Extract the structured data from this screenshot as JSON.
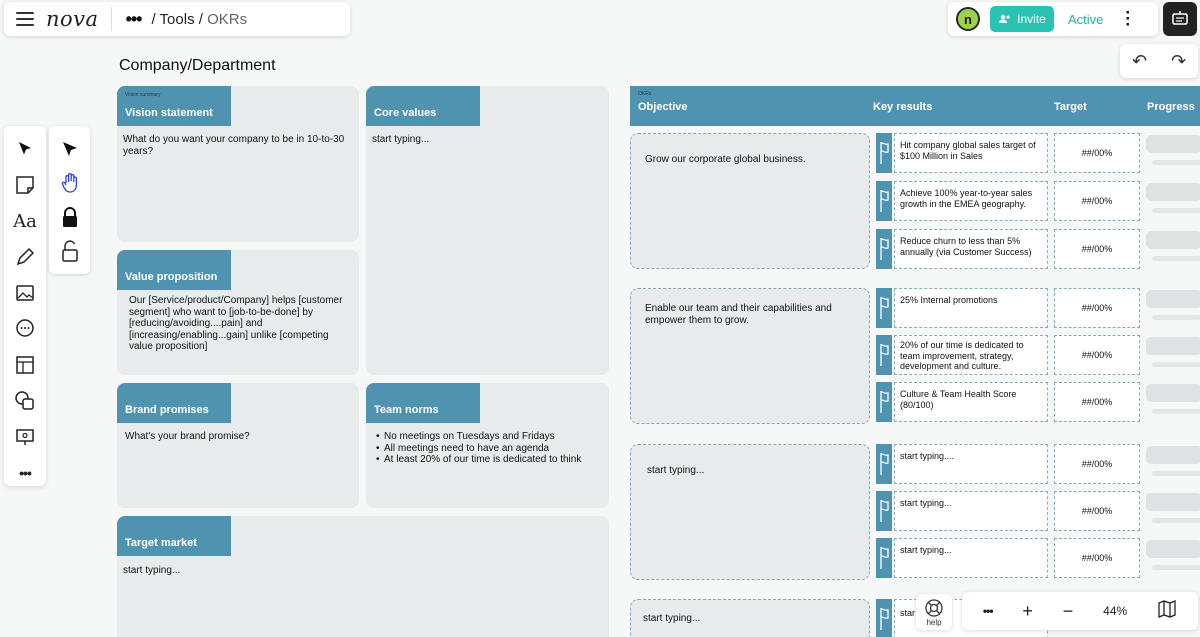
{
  "app": {
    "logo": "nova"
  },
  "breadcrumb": {
    "items": [
      "Tools",
      "OKRs"
    ],
    "separator": "/"
  },
  "header": {
    "invite_label": "Invite",
    "status": "Active",
    "avatar_letter": "n"
  },
  "board": {
    "title": "Company/Department",
    "boxes": {
      "vision": {
        "small_label": "Vision summary",
        "title": "Vision statement",
        "body": "What do you want your company to be in 10-to-30 years?"
      },
      "core_values": {
        "title": "Core values",
        "body": "start typing..."
      },
      "value_prop": {
        "title": "Value proposition",
        "body": "Our [Service/product/Company] helps [customer segment] who want to [job-to-be-done] by [reducing/avoiding....pain] and [increasing/enabling...gain] unlike [competing value proposition]"
      },
      "brand": {
        "title": "Brand promises",
        "body": "What's your brand promise?"
      },
      "team_norms": {
        "title": "Team norms",
        "items": [
          "No meetings on Tuesdays and Fridays",
          "All meetings need to have an agenda",
          "At least 20% of our time is dedicated to think"
        ]
      },
      "target_market": {
        "title": "Target market",
        "body": "start typing..."
      }
    }
  },
  "okr": {
    "small_label": "OKRs",
    "columns": {
      "objective": "Objective",
      "key_results": "Key results",
      "target": "Target",
      "progress": "Progress"
    },
    "objectives": [
      {
        "text": "Grow our corporate global business.",
        "key_results": [
          {
            "text": "Hit company global sales target of $100 Million in Sales",
            "target": "##/00%"
          },
          {
            "text": "Achieve 100% year-to-year sales growth in the EMEA geography.",
            "target": "##/00%"
          },
          {
            "text": "Reduce churn to less than 5% annually (via Customer Success)",
            "target": "##/00%"
          }
        ]
      },
      {
        "text": "Enable our team and their capabilities and empower them to grow.",
        "key_results": [
          {
            "text": "25% Internal promotions",
            "target": "##/00%"
          },
          {
            "text": "20% of our time is dedicated to team improvement, strategy, development and culture.",
            "target": "##/00%"
          },
          {
            "text": "Culture & Team Health Score (80/100)",
            "target": "##/00%"
          }
        ]
      },
      {
        "text": "start typing...",
        "key_results": [
          {
            "text": "start typing....",
            "target": "##/00%"
          },
          {
            "text": "start typing...",
            "target": "##/00%"
          },
          {
            "text": "start typing...",
            "target": "##/00%"
          }
        ]
      },
      {
        "text": "start typing...",
        "key_results": [
          {
            "text": "star",
            "target": ""
          }
        ]
      }
    ]
  },
  "footer": {
    "help_label": "help",
    "zoom": "44%"
  },
  "icons": {
    "toolbar": [
      "select-icon",
      "sticky-note-icon",
      "text-icon",
      "pen-icon",
      "image-icon",
      "comment-icon",
      "table-icon",
      "shapes-icon",
      "presentation-icon",
      "more-icon"
    ],
    "subtools": [
      "pointer-icon",
      "hand-icon",
      "lock-icon",
      "unlock-icon"
    ]
  },
  "colors": {
    "section_header": "#4f93b0",
    "invite": "#29c3b4",
    "box_bg": "#e8ebec"
  }
}
